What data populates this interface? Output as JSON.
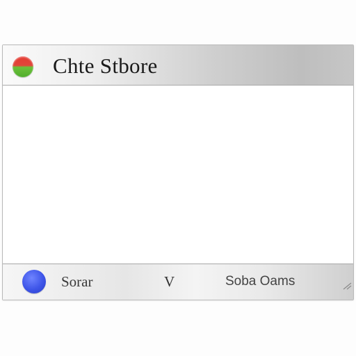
{
  "window": {
    "title": "Chte Stbore",
    "title_dot_icon": "red-green-window-dot-icon"
  },
  "statusbar": {
    "left_icon": "blue-circle-icon",
    "left_text": "Sorar",
    "middle_text": "V",
    "right_text": "Soba Oams",
    "grip_icon": "resize-grip-icon"
  },
  "colors": {
    "title_dot_top": "#e53b33",
    "title_dot_bottom": "#4fae2c",
    "status_dot": "#3e55e8",
    "chrome_gray": "#c6c6c6"
  }
}
